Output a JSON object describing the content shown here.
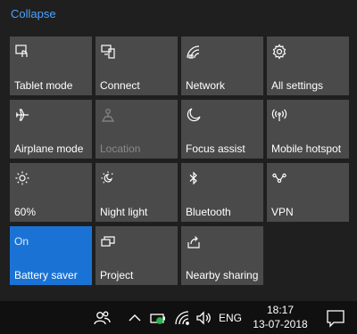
{
  "header": {
    "collapse_label": "Collapse"
  },
  "tiles": [
    {
      "label": "Tablet mode",
      "icon": "tablet-mode-icon",
      "state": "",
      "active": false,
      "disabled": false
    },
    {
      "label": "Connect",
      "icon": "connect-icon",
      "state": "",
      "active": false,
      "disabled": false
    },
    {
      "label": "Network",
      "icon": "network-icon",
      "state": "",
      "active": false,
      "disabled": false
    },
    {
      "label": "All settings",
      "icon": "gear-icon",
      "state": "",
      "active": false,
      "disabled": false
    },
    {
      "label": "Airplane mode",
      "icon": "airplane-icon",
      "state": "",
      "active": false,
      "disabled": false
    },
    {
      "label": "Location",
      "icon": "location-icon",
      "state": "",
      "active": false,
      "disabled": true
    },
    {
      "label": "Focus assist",
      "icon": "moon-icon",
      "state": "",
      "active": false,
      "disabled": false
    },
    {
      "label": "Mobile hotspot",
      "icon": "hotspot-icon",
      "state": "",
      "active": false,
      "disabled": false
    },
    {
      "label": "60%",
      "icon": "brightness-icon",
      "state": "",
      "active": false,
      "disabled": false
    },
    {
      "label": "Night light",
      "icon": "night-light-icon",
      "state": "",
      "active": false,
      "disabled": false
    },
    {
      "label": "Bluetooth",
      "icon": "bluetooth-icon",
      "state": "",
      "active": false,
      "disabled": false
    },
    {
      "label": "VPN",
      "icon": "vpn-icon",
      "state": "",
      "active": false,
      "disabled": false
    },
    {
      "label": "Battery saver",
      "icon": "",
      "state": "On",
      "active": true,
      "disabled": false
    },
    {
      "label": "Project",
      "icon": "project-icon",
      "state": "",
      "active": false,
      "disabled": false
    },
    {
      "label": "Nearby sharing",
      "icon": "nearby-sharing-icon",
      "state": "",
      "active": false,
      "disabled": false
    }
  ],
  "taskbar": {
    "icons": [
      "people-icon",
      "chevron-up-icon",
      "battery-icon",
      "wifi-icon",
      "volume-icon"
    ],
    "language": "ENG",
    "time": "18:17",
    "date": "13-07-2018",
    "notification_icon": "notification-icon"
  },
  "colors": {
    "background": "#1f1f1f",
    "tile": "#4a4a4a",
    "accent": "#1a73d4",
    "link": "#4aa3ff",
    "taskbar": "#101010"
  }
}
